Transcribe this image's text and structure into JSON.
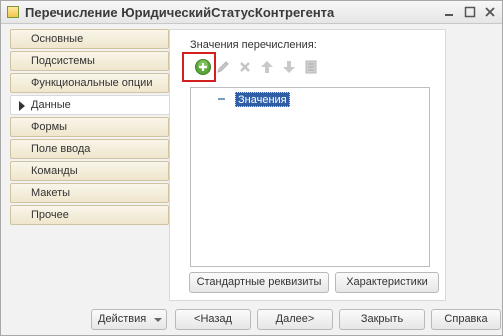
{
  "window": {
    "title": "Перечисление ЮридическийСтатусКонтрегента"
  },
  "tabs": [
    {
      "label": "Основные",
      "active": false
    },
    {
      "label": "Подсистемы",
      "active": false
    },
    {
      "label": "Функциональные опции",
      "active": false
    },
    {
      "label": "Данные",
      "active": true
    },
    {
      "label": "Формы",
      "active": false
    },
    {
      "label": "Поле ввода",
      "active": false
    },
    {
      "label": "Команды",
      "active": false
    },
    {
      "label": "Макеты",
      "active": false
    },
    {
      "label": "Прочее",
      "active": false
    }
  ],
  "panel": {
    "label": "Значения перечисления:",
    "toolbar": [
      {
        "icon": "add-icon",
        "enabled": true
      },
      {
        "icon": "edit-icon",
        "enabled": false
      },
      {
        "icon": "delete-icon",
        "enabled": false
      },
      {
        "icon": "move-up-icon",
        "enabled": false
      },
      {
        "icon": "move-down-icon",
        "enabled": false
      },
      {
        "icon": "sort-icon",
        "enabled": false
      }
    ],
    "tree": {
      "selected_item": "Значения"
    },
    "buttons": {
      "standard_attributes": "Стандартные реквизиты",
      "characteristics": "Характеристики"
    }
  },
  "footer": {
    "actions": "Действия",
    "back": "<Назад",
    "next": "Далее>",
    "close": "Закрыть",
    "help": "Справка"
  },
  "colors": {
    "highlight": "#d21f1f",
    "selection": "#2f5ea7",
    "tab_bg": "#efe6cc"
  }
}
